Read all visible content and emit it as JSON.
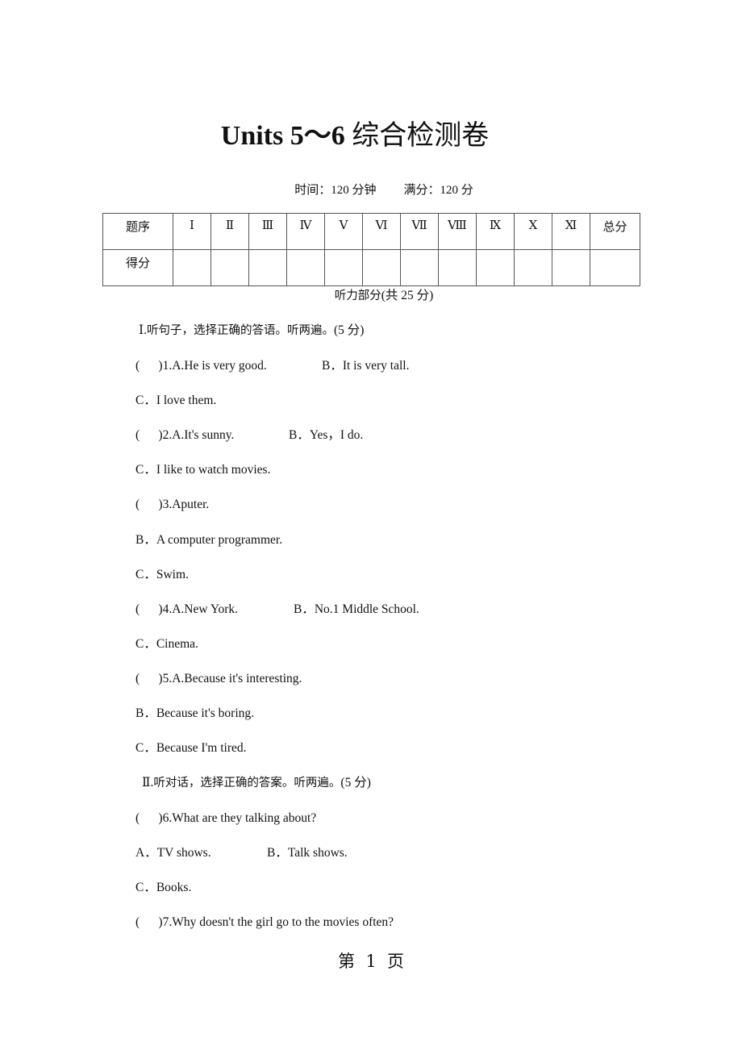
{
  "document": {
    "title_en": "Units 5～6 ",
    "title_zh": "综合检测卷",
    "time_label": "时间：120 分钟",
    "score_label": "满分：120 分"
  },
  "score_table": {
    "row1_header": "题序",
    "row2_header": "得分",
    "columns": [
      "Ⅰ",
      "Ⅱ",
      "Ⅲ",
      "Ⅳ",
      "Ⅴ",
      "Ⅵ",
      "Ⅶ",
      "Ⅷ",
      "Ⅸ",
      "Ⅹ",
      "Ⅺ"
    ],
    "total_header": "总分"
  },
  "listening": {
    "heading_zh": "听力部分",
    "heading_pts": "(共 25 分)"
  },
  "part1": {
    "heading_num": "Ⅰ.",
    "heading_zh": "听句子，选择正确的答语。听两遍。",
    "heading_pts": "(5 分)",
    "questions": [
      {
        "q": "(      )1.A.He is very good.",
        "b": "B．It is very tall.",
        "c": "C．I love them."
      },
      {
        "q": "(      )2.A.It's sunny.",
        "b": "B．Yes，I do.",
        "c": "C．I like to watch movies."
      },
      {
        "q": "(      )3.Aputer.",
        "b": "B．A computer programmer.",
        "c": "C．Swim."
      },
      {
        "q": "(      )4.A.New York.",
        "b": "B．No.1 Middle School.",
        "c": "C．Cinema."
      },
      {
        "q": "(      )5.A.Because it's interesting.",
        "b": "B．Because it's boring.",
        "c": "C．Because I'm tired."
      }
    ]
  },
  "part2": {
    "heading_num": "Ⅱ.",
    "heading_zh": "听对话，选择正确的答案。听两遍。",
    "heading_pts": "(5 分)",
    "q6": "(      )6.What are they talking about?",
    "q6_a": "A．TV shows.",
    "q6_b": "B．Talk shows.",
    "q6_c": "C．Books.",
    "q7": "(      )7.Why doesn't the girl go to the movies often?"
  },
  "footer": {
    "page_label": "第  1  页"
  }
}
